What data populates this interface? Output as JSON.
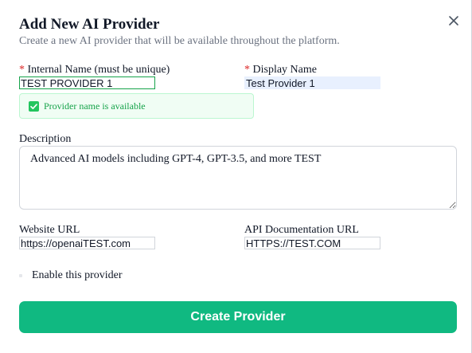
{
  "modal": {
    "title": "Add New AI Provider",
    "subtitle": "Create a new AI provider that will be available throughout the platform.",
    "close_icon": "close-icon"
  },
  "form": {
    "internal_name": {
      "required_mark": "*",
      "label": "Internal Name (must be unique)",
      "value": "TEST PROVIDER 1"
    },
    "availability": {
      "icon": "check-square-icon",
      "message": "Provider name is available",
      "color": "#16a34a"
    },
    "display_name": {
      "required_mark": "*",
      "label": "Display Name",
      "value": "Test Provider 1"
    },
    "description": {
      "label": "Description",
      "value": "Advanced AI models including GPT-4, GPT-3.5, and more TEST"
    },
    "website_url": {
      "label": "Website URL",
      "value": "https://openaiTEST.com"
    },
    "api_docs_url": {
      "label": "API Documentation URL",
      "value": "HTTPS://TEST.COM"
    },
    "enable": {
      "label": "Enable this provider",
      "checked": false
    }
  },
  "actions": {
    "submit_label": "Create Provider",
    "accent_color": "#10b981"
  }
}
